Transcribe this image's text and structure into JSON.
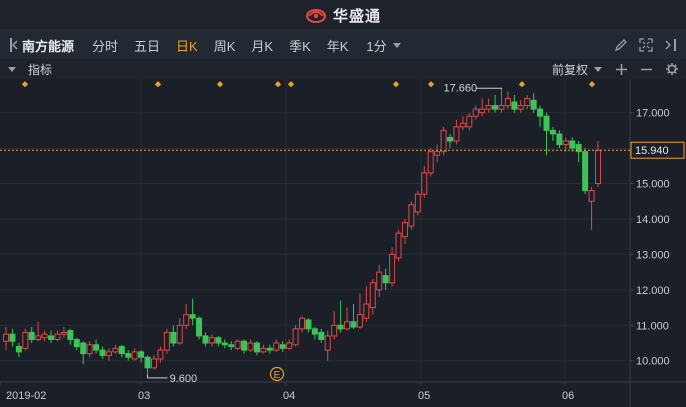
{
  "app": {
    "logo_text": "华盛通"
  },
  "toolbar": {
    "stock_name": "南方能源",
    "tabs": [
      {
        "label": "分时",
        "active": false
      },
      {
        "label": "五日",
        "active": false
      },
      {
        "label": "日K",
        "active": true
      },
      {
        "label": "周K",
        "active": false
      },
      {
        "label": "月K",
        "active": false
      },
      {
        "label": "季K",
        "active": false
      },
      {
        "label": "年K",
        "active": false
      }
    ],
    "interval_select": "1分"
  },
  "indicator_bar": {
    "label": "指标",
    "adjust_select": "前复权"
  },
  "colors": {
    "up": "#e04848",
    "down": "#3ec35a",
    "price_line": "#f0a030",
    "marker": "#f0a030"
  },
  "chart_data": {
    "type": "candlestick",
    "x_tick_labels": [
      "2019-02",
      "03",
      "04",
      "05",
      "06"
    ],
    "y_tick_labels": [
      "17.000",
      "16.000",
      "15.000",
      "14.000",
      "13.000",
      "12.000",
      "11.000",
      "10.000"
    ],
    "ylim": [
      9.4,
      17.95
    ],
    "current_price": "15.940",
    "annotations": {
      "high": "17.660",
      "low": "9.600",
      "event_marker": "E"
    },
    "candles": [
      [
        10.55,
        10.75,
        10.95,
        10.3
      ],
      [
        10.75,
        10.55,
        10.9,
        10.4
      ],
      [
        10.4,
        10.25,
        10.5,
        10.1
      ],
      [
        10.35,
        10.8,
        10.9,
        10.3
      ],
      [
        10.8,
        10.6,
        10.95,
        10.5
      ],
      [
        10.6,
        10.7,
        11.1,
        10.55
      ],
      [
        10.65,
        10.75,
        10.85,
        10.55
      ],
      [
        10.7,
        10.6,
        10.85,
        10.5
      ],
      [
        10.6,
        10.75,
        10.85,
        10.55
      ],
      [
        10.75,
        10.8,
        10.95,
        10.65
      ],
      [
        10.85,
        10.6,
        10.9,
        10.45
      ],
      [
        10.6,
        10.4,
        10.65,
        10.3
      ],
      [
        10.5,
        10.2,
        10.55,
        9.9
      ],
      [
        10.2,
        10.45,
        10.55,
        10.1
      ],
      [
        10.45,
        10.3,
        10.6,
        10.2
      ],
      [
        10.3,
        10.15,
        10.4,
        10.05
      ],
      [
        10.15,
        10.25,
        10.35,
        10.0
      ],
      [
        10.25,
        10.35,
        10.45,
        10.2
      ],
      [
        10.4,
        10.2,
        10.45,
        10.1
      ],
      [
        10.2,
        10.1,
        10.3,
        10.0
      ],
      [
        10.05,
        10.25,
        10.35,
        10.0
      ],
      [
        10.25,
        10.1,
        10.3,
        9.95
      ],
      [
        10.1,
        9.8,
        10.15,
        9.6
      ],
      [
        9.8,
        10.05,
        10.15,
        9.75
      ],
      [
        10.05,
        10.3,
        10.4,
        9.95
      ],
      [
        10.3,
        10.8,
        10.9,
        10.2
      ],
      [
        10.8,
        10.5,
        11.0,
        10.4
      ],
      [
        10.5,
        11.0,
        11.2,
        10.45
      ],
      [
        11.0,
        11.3,
        11.6,
        10.9
      ],
      [
        11.3,
        11.2,
        11.75,
        11.0
      ],
      [
        11.2,
        10.7,
        11.25,
        10.6
      ],
      [
        10.7,
        10.5,
        10.8,
        10.4
      ],
      [
        10.5,
        10.65,
        10.75,
        10.4
      ],
      [
        10.65,
        10.5,
        10.7,
        10.4
      ],
      [
        10.5,
        10.45,
        10.6,
        10.35
      ],
      [
        10.45,
        10.4,
        10.55,
        10.3
      ],
      [
        10.35,
        10.55,
        10.6,
        10.3
      ],
      [
        10.55,
        10.3,
        10.6,
        10.2
      ],
      [
        10.3,
        10.5,
        10.6,
        10.25
      ],
      [
        10.5,
        10.25,
        10.55,
        10.15
      ],
      [
        10.25,
        10.35,
        10.45,
        10.2
      ],
      [
        10.35,
        10.3,
        10.45,
        10.2
      ],
      [
        10.3,
        10.5,
        10.6,
        10.25
      ],
      [
        10.45,
        10.35,
        10.55,
        10.25
      ],
      [
        10.35,
        10.5,
        10.6,
        10.3
      ],
      [
        10.45,
        10.9,
        11.0,
        10.4
      ],
      [
        10.9,
        11.2,
        11.25,
        10.8
      ],
      [
        11.15,
        10.9,
        11.2,
        10.8
      ],
      [
        10.9,
        10.75,
        10.95,
        10.6
      ],
      [
        10.8,
        10.6,
        10.9,
        10.5
      ],
      [
        10.3,
        10.7,
        10.85,
        10.0
      ],
      [
        10.7,
        11.0,
        11.4,
        10.6
      ],
      [
        11.0,
        10.9,
        11.7,
        10.8
      ],
      [
        10.9,
        11.1,
        11.5,
        10.85
      ],
      [
        11.1,
        10.95,
        11.6,
        10.9
      ],
      [
        10.95,
        11.3,
        11.9,
        10.9
      ],
      [
        11.2,
        11.6,
        12.1,
        11.1
      ],
      [
        11.5,
        12.2,
        12.3,
        11.3
      ],
      [
        12.0,
        12.5,
        12.7,
        11.8
      ],
      [
        12.4,
        12.2,
        12.6,
        12.0
      ],
      [
        12.2,
        13.0,
        13.2,
        12.1
      ],
      [
        12.9,
        13.6,
        13.7,
        12.8
      ],
      [
        13.5,
        13.9,
        14.0,
        13.3
      ],
      [
        13.8,
        14.4,
        14.5,
        13.7
      ],
      [
        14.2,
        14.7,
        14.8,
        14.1
      ],
      [
        14.7,
        15.3,
        15.5,
        14.6
      ],
      [
        15.3,
        15.9,
        16.0,
        15.2
      ],
      [
        15.8,
        15.9,
        16.1,
        15.6
      ],
      [
        15.9,
        16.5,
        16.6,
        15.8
      ],
      [
        16.3,
        16.2,
        16.4,
        16.0
      ],
      [
        16.2,
        16.6,
        16.8,
        16.1
      ],
      [
        16.6,
        16.7,
        16.9,
        16.5
      ],
      [
        16.6,
        16.9,
        17.0,
        16.5
      ],
      [
        16.9,
        17.1,
        17.2,
        16.8
      ],
      [
        17.0,
        17.1,
        17.4,
        16.9
      ],
      [
        17.1,
        17.2,
        17.4,
        17.0
      ],
      [
        17.2,
        17.1,
        17.5,
        17.0
      ],
      [
        17.1,
        17.2,
        17.66,
        17.0
      ],
      [
        17.2,
        17.4,
        17.6,
        17.1
      ],
      [
        17.3,
        17.1,
        17.5,
        17.0
      ],
      [
        17.1,
        17.2,
        17.35,
        17.0
      ],
      [
        17.2,
        17.4,
        17.5,
        17.1
      ],
      [
        17.35,
        17.1,
        17.55,
        17.0
      ],
      [
        17.1,
        16.9,
        17.2,
        16.6
      ],
      [
        16.9,
        16.5,
        17.0,
        15.8
      ],
      [
        16.5,
        16.4,
        16.6,
        16.2
      ],
      [
        16.4,
        16.1,
        16.5,
        16.0
      ],
      [
        16.1,
        16.2,
        16.3,
        15.9
      ],
      [
        16.2,
        16.0,
        16.3,
        15.9
      ],
      [
        16.1,
        15.9,
        16.2,
        15.6
      ],
      [
        15.9,
        14.8,
        16.0,
        14.7
      ],
      [
        14.5,
        14.8,
        14.9,
        13.7
      ],
      [
        15.0,
        15.94,
        16.2,
        14.9
      ]
    ]
  }
}
